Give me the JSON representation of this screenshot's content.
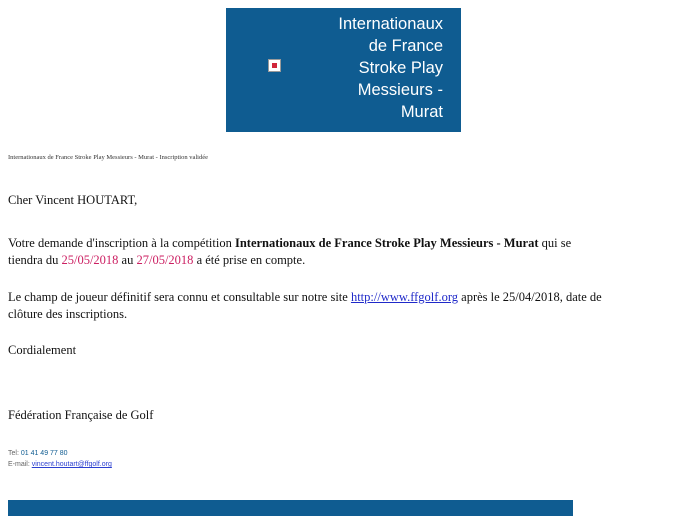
{
  "banner": {
    "lines": [
      "Internationaux",
      "de France",
      "Stroke Play",
      "Messieurs -",
      "Murat"
    ]
  },
  "subject_line": "Internationaux de France Stroke Play Messieurs - Murat - Inscription validée",
  "greeting": "Cher Vincent HOUTART,",
  "paragraph1": {
    "intro": "Votre demande d'inscription à la compétition ",
    "competition": "Internationaux de France Stroke Play Messieurs - Murat",
    "middle": " qui se",
    "line2_start": "tiendra du ",
    "date_start": "25/05/2018",
    "connector": " au ",
    "date_end": "27/05/2018",
    "ending": " a été prise en compte."
  },
  "paragraph2": {
    "line1_start": "Le champ de joueur définitif sera connu et consultable sur notre site ",
    "link": "http://www.ffgolf.org",
    "line1_end": " après le 25/04/2018, date de",
    "line2": "clôture des inscriptions."
  },
  "closing": "Cordialement",
  "signature": "Fédération Française de Golf",
  "contact": {
    "tel_label": "Tel: ",
    "tel_value": "01 41 49 77 80",
    "email_label": "E-mail: ",
    "email_value": "vincent.houtart@ffgolf.org"
  },
  "colors": {
    "brand": "#0f5c91",
    "date": "#cc1f62",
    "link": "#1f29c9"
  }
}
